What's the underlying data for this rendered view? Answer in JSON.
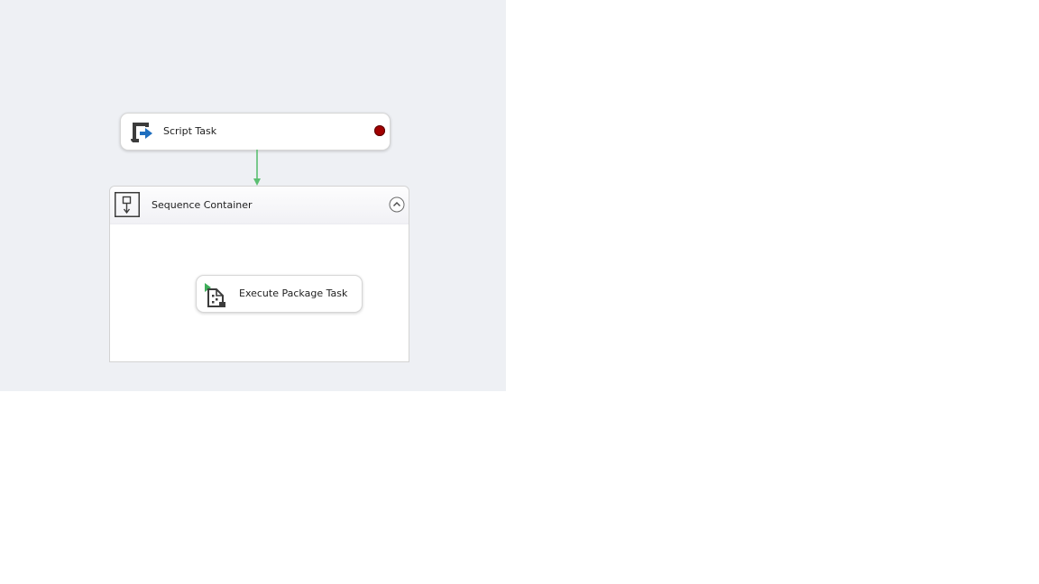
{
  "designer": {
    "tasks": [
      {
        "label": "Script Task",
        "icon": "script-task-icon",
        "breakpoint": true
      },
      {
        "label": "Execute Package Task",
        "icon": "execute-package-task-icon"
      }
    ],
    "container": {
      "label": "Sequence Container",
      "icon": "sequence-container-icon",
      "state": "expanded"
    },
    "precedence_constraint": {
      "from": "Script Task",
      "to": "Sequence Container",
      "color": "#5cbf72"
    },
    "colors": {
      "canvas": "#eef0f4",
      "breakpoint": "#a10000",
      "accent_blue": "#1e6fbf"
    }
  }
}
